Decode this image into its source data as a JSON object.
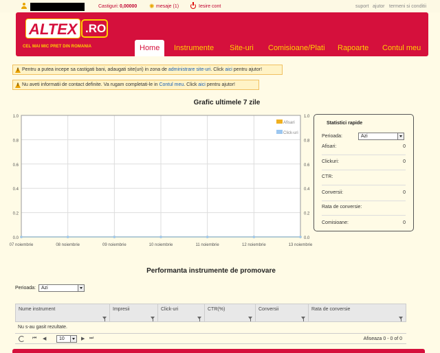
{
  "topbar": {
    "castiguri_label": "Castiguri:",
    "castiguri_value": "0,00000",
    "messages": "mesaje (1)",
    "logout": "Iesire cont",
    "links": [
      "suport",
      "ajutor",
      "termeni si conditii"
    ]
  },
  "header": {
    "logo_text": "ALTEX",
    "logo_domain": ".RO",
    "slogan": "CEL MAI MIC PRET DIN ROMANIA",
    "nav": [
      "Home",
      "Instrumente",
      "Site-uri",
      "Comisioane/Plati",
      "Rapoarte",
      "Contul meu"
    ],
    "active_nav": "Home"
  },
  "alerts": [
    {
      "pre": "Pentru a putea incepe sa castigati bani, adaugati site(uri) in zona de ",
      "link1": "administrare site-uri",
      "mid": ". Click ",
      "link2": "aici",
      "post": " pentru ajutor!"
    },
    {
      "pre": "Nu aveti informatii de contact definite. Va rugam completati-le in ",
      "link1": "Contul meu",
      "mid": ". Click ",
      "link2": "aici",
      "post": " pentru ajutor!"
    }
  ],
  "chart_data": {
    "type": "line",
    "title": "Grafic ultimele 7 zile",
    "categories": [
      "07 noiembrie",
      "08 noiembrie",
      "09 noiembrie",
      "10 noiembrie",
      "11 noiembrie",
      "12 noiembrie",
      "13 noiembrie"
    ],
    "series": [
      {
        "name": "Afisari",
        "color": "#f0b020",
        "values": [
          0,
          0,
          0,
          0,
          0,
          0,
          0
        ]
      },
      {
        "name": "Click-uri",
        "color": "#9cc7f0",
        "values": [
          0,
          0,
          0,
          0,
          0,
          0,
          0
        ]
      }
    ],
    "ylim": [
      0,
      1
    ],
    "yticks": [
      "0.0",
      "0.2",
      "0.4",
      "0.6",
      "0.8",
      "1.0"
    ],
    "grid": true,
    "legend": "top-right"
  },
  "stats": {
    "title": "Statistici rapide",
    "period_label": "Perioada:",
    "period_value": "Azi",
    "rows": [
      {
        "label": "Afisari:",
        "value": "0"
      },
      {
        "label": "Clickuri:",
        "value": "0"
      },
      {
        "label": "CTR:",
        "value": ""
      },
      {
        "label": "Conversii:",
        "value": "0"
      },
      {
        "label": "Rata de conversie:",
        "value": ""
      },
      {
        "label": "Comisioane:",
        "value": "0"
      }
    ]
  },
  "performance": {
    "title": "Performanta instrumente de promovare",
    "period_label": "Perioada:",
    "period_value": "Azi",
    "columns": [
      "Nume instrument",
      "Impresii",
      "Click-uri",
      "CTR(%)",
      "Conversii",
      "Rata de conversie"
    ],
    "empty_text": "Nu s-au gasit rezultate.",
    "page_size": "10",
    "page_info": "Afiseaza 0 - 0 of 0"
  }
}
